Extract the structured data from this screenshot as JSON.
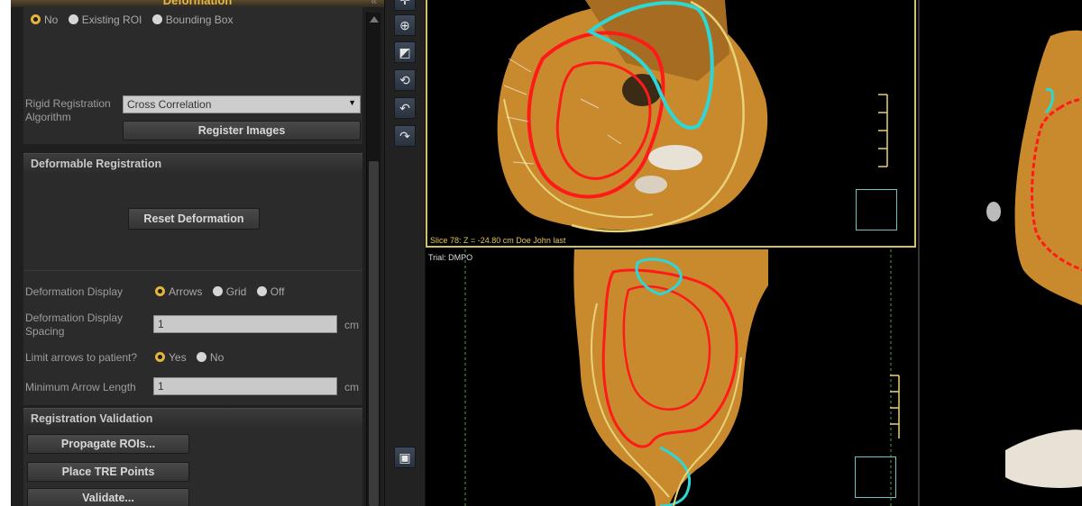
{
  "panel": {
    "title": "Deformation",
    "rigid": {
      "roi_options": [
        "No",
        "Existing ROI",
        "Bounding Box"
      ],
      "algorithm_label_line1": "Rigid Registration",
      "algorithm_label_line2": "Algorithm",
      "algorithm_value": "Cross Correlation",
      "register_button": "Register Images"
    },
    "deformable": {
      "header": "Deformable Registration",
      "reset_button": "Reset Deformation",
      "display_label": "Deformation Display",
      "display_options": [
        "Arrows",
        "Grid",
        "Off"
      ],
      "spacing_label_line1": "Deformation Display",
      "spacing_label_line2": "Spacing",
      "spacing_value": "1",
      "spacing_unit": "cm",
      "limit_label": "Limit arrows to patient?",
      "limit_options": [
        "Yes",
        "No"
      ],
      "min_length_label": "Minimum Arrow Length",
      "min_length_value": "1",
      "min_length_unit": "cm"
    },
    "validation": {
      "header": "Registration Validation",
      "propagate_button": "Propagate ROIs...",
      "tre_button": "Place TRE Points",
      "validate_button": "Validate..."
    }
  },
  "views": {
    "top_info": "Slice 78: Z = -24.80 cm Doe John last",
    "bottom_trial": "Trial: DMPO"
  },
  "colors": {
    "accent": "#e5b43c",
    "roi_red": "#ff1a1a",
    "roi_cyan": "#2fd6d6",
    "roi_yellow": "#e8d27a",
    "tissue": "#c98a2e"
  }
}
